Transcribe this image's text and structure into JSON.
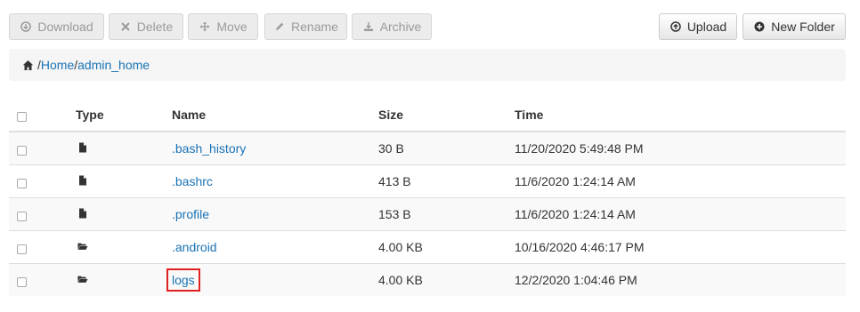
{
  "toolbar": {
    "download": "Download",
    "delete": "Delete",
    "move": "Move",
    "rename": "Rename",
    "archive": "Archive",
    "upload": "Upload",
    "new_folder": "New Folder"
  },
  "breadcrumb": {
    "separator": "/",
    "parts": [
      "Home",
      "admin_home"
    ]
  },
  "table": {
    "headers": {
      "type": "Type",
      "name": "Name",
      "size": "Size",
      "time": "Time"
    },
    "rows": [
      {
        "type": "file",
        "name": ".bash_history",
        "size": "30 B",
        "time": "11/20/2020 5:49:48 PM",
        "highlighted": false
      },
      {
        "type": "file",
        "name": ".bashrc",
        "size": "413 B",
        "time": "11/6/2020 1:24:14 AM",
        "highlighted": false
      },
      {
        "type": "file",
        "name": ".profile",
        "size": "153 B",
        "time": "11/6/2020 1:24:14 AM",
        "highlighted": false
      },
      {
        "type": "folder",
        "name": ".android",
        "size": "4.00 KB",
        "time": "10/16/2020 4:46:17 PM",
        "highlighted": false
      },
      {
        "type": "folder",
        "name": "logs",
        "size": "4.00 KB",
        "time": "12/2/2020 1:04:46 PM",
        "highlighted": true
      }
    ]
  },
  "icons": {
    "download": "download-icon",
    "delete": "close-icon",
    "move": "move-arrows-icon",
    "rename": "pencil-icon",
    "archive": "archive-download-icon",
    "upload": "upload-circle-icon",
    "new_folder": "plus-circle-icon",
    "home": "home-icon",
    "file": "file-icon",
    "folder": "folder-open-icon"
  },
  "colors": {
    "link": "#1a73b5",
    "highlight": "#e02020"
  }
}
